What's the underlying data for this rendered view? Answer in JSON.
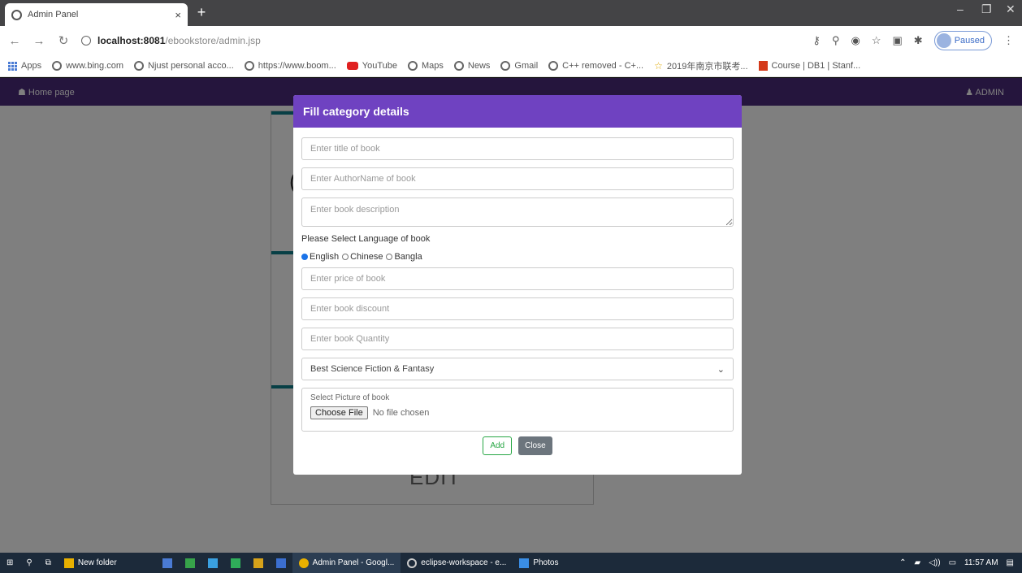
{
  "browser": {
    "tab_title": "Admin Panel",
    "tab_close": "×",
    "new_tab": "+",
    "window_controls": [
      "–",
      "❐",
      "✕"
    ],
    "url_host": "localhost:8081",
    "url_path": "/ebookstore/admin.jsp",
    "profile_status": "Paused",
    "bookmarks": [
      {
        "label": "Apps",
        "icon": "apps-grid-icon"
      },
      {
        "label": "www.bing.com",
        "icon": "globe-icon"
      },
      {
        "label": "Njust personal acco...",
        "icon": "globe-icon"
      },
      {
        "label": "https://www.boom...",
        "icon": "globe-icon"
      },
      {
        "label": "YouTube",
        "icon": "youtube-icon"
      },
      {
        "label": "Maps",
        "icon": "globe-icon"
      },
      {
        "label": "News",
        "icon": "globe-icon"
      },
      {
        "label": "Gmail",
        "icon": "globe-icon"
      },
      {
        "label": "C++ removed - C+...",
        "icon": "globe-icon"
      },
      {
        "label": "2019年南京市联考...",
        "icon": "star-icon"
      },
      {
        "label": "Course | DB1 | Stanf...",
        "icon": "course-icon"
      }
    ]
  },
  "app": {
    "nav_home": "☗ Home page",
    "nav_admin": "♟ ADMIN"
  },
  "background": {
    "edit_label": "EDIT"
  },
  "modal": {
    "title": "Fill category details",
    "title_placeholder": "Enter title of book",
    "author_placeholder": "Enter AuthorName of book",
    "description_placeholder": "Enter book description",
    "language_label": "Please Select Language of book",
    "languages": [
      "English",
      "Chinese",
      "Bangla"
    ],
    "selected_language": "English",
    "price_placeholder": "Enter price of book",
    "discount_placeholder": "Enter book discount",
    "quantity_placeholder": "Enter book Quantity",
    "category_selected": "Best Science Fiction & Fantasy",
    "picture_label": "Select Picture of book",
    "choose_file_label": "Choose File",
    "no_file_text": "No file chosen",
    "add_label": "Add",
    "close_label": "Close"
  },
  "taskbar": {
    "items": [
      {
        "label": "New folder"
      },
      {
        "label": "Admin Panel - Googl..."
      },
      {
        "label": "eclipse-workspace - e..."
      },
      {
        "label": "Photos"
      }
    ],
    "clock": "11:57 AM"
  }
}
